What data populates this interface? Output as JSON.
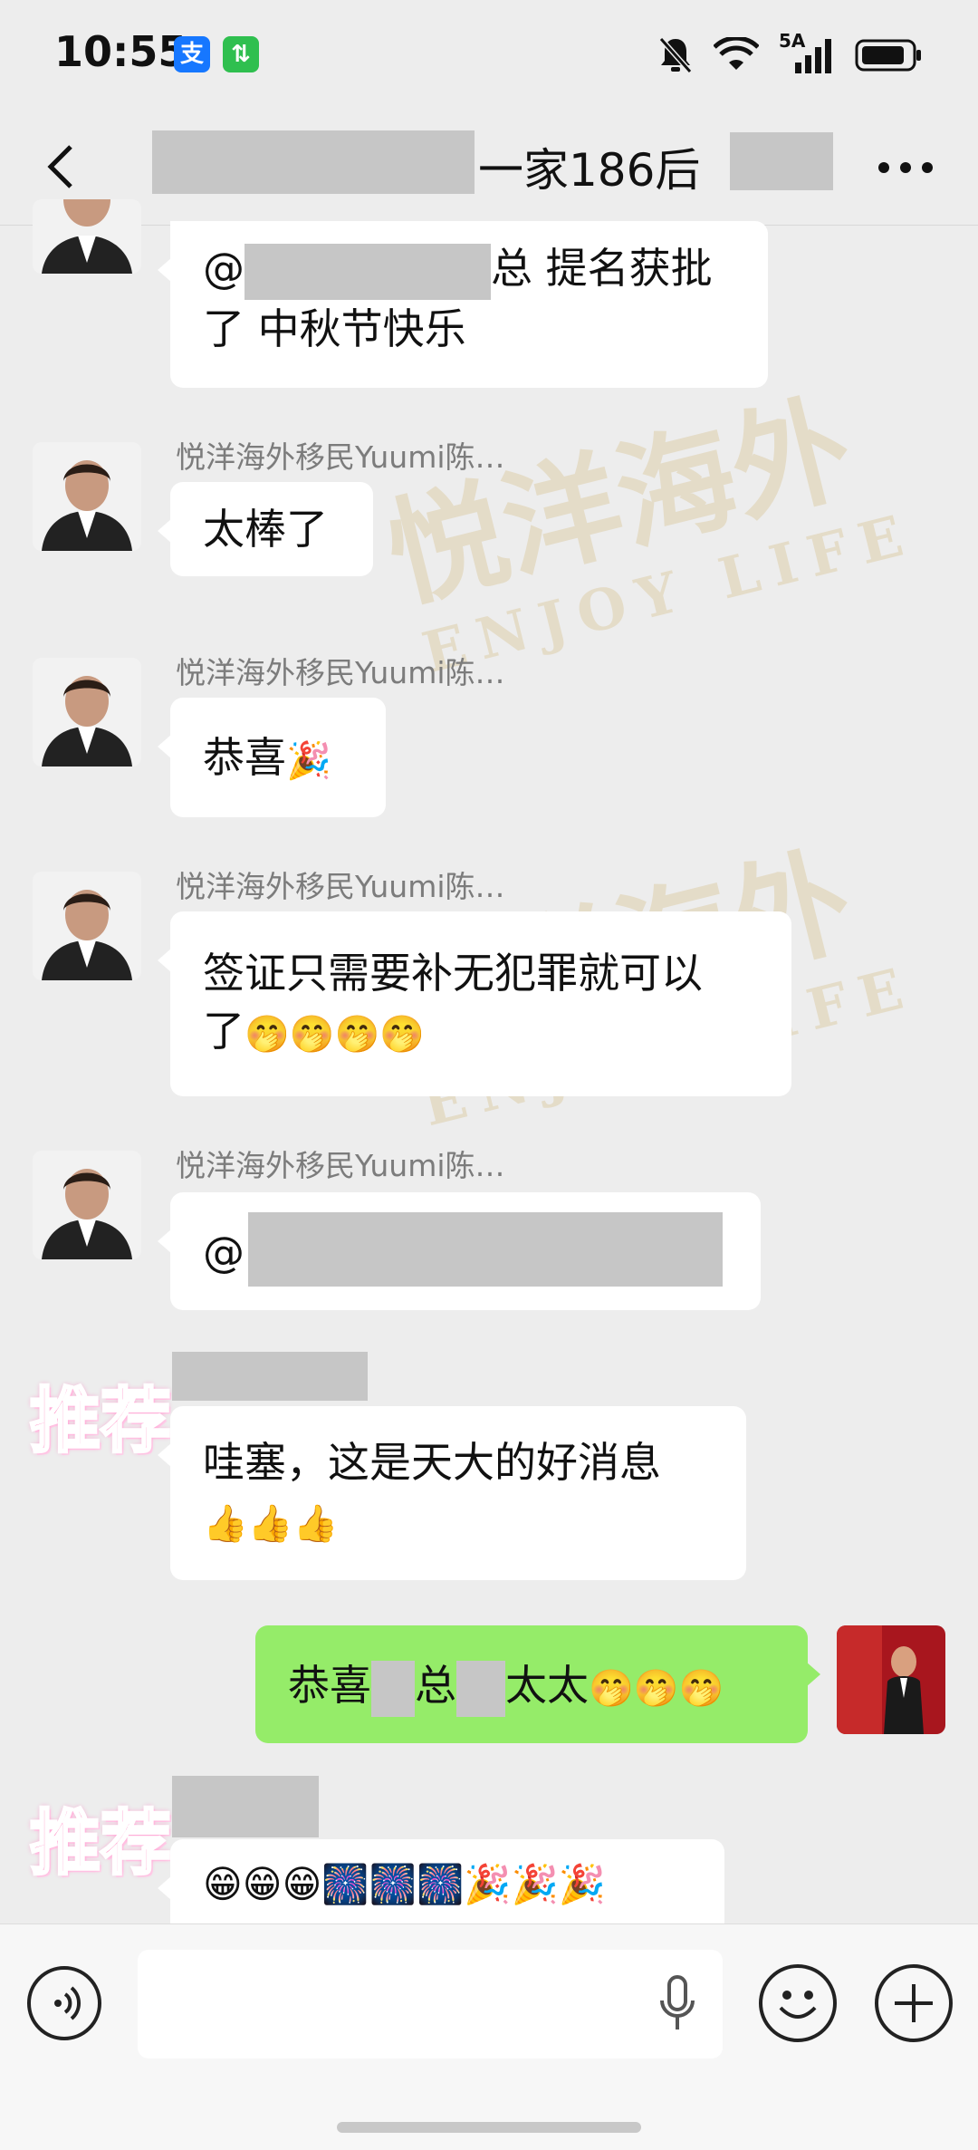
{
  "status_bar": {
    "time": "10:55",
    "app_icons": [
      {
        "name": "alipay-icon",
        "glyph": "支",
        "color": "#1677ff"
      },
      {
        "name": "data-transfer-icon",
        "glyph": "⇅",
        "color": "#2fbf4f"
      }
    ],
    "network_label": "5A"
  },
  "header": {
    "title": "一家186后（"
  },
  "messages": [
    {
      "type": "text",
      "mention": "@",
      "text": "总 提名获批",
      "text2": "了 中秋节快乐"
    },
    {
      "type": "text",
      "sender": "悦洋海外移民Yuumi陈…",
      "text": "太棒了"
    },
    {
      "type": "text",
      "sender": "悦洋海外移民Yuumi陈…",
      "text": "恭喜",
      "emoji": "🎉"
    },
    {
      "type": "text",
      "sender": "悦洋海外移民Yuumi陈…",
      "text": "签证只需要补无犯罪就可以",
      "text2": "了",
      "emoji": "🤭🤭🤭🤭"
    },
    {
      "type": "text",
      "sender": "悦洋海外移民Yuumi陈…",
      "mention": "@"
    },
    {
      "type": "text",
      "sticker": "推荐",
      "text": "哇塞，这是天大的好消息",
      "emoji": "👍👍👍"
    },
    {
      "type": "text",
      "own": true,
      "text_a": "恭喜",
      "text_b": "总",
      "text_c": "太太",
      "emoji": "🤭🤭🤭"
    },
    {
      "type": "text",
      "sticker": "推荐",
      "emoji": "😁😁😁🎆🎆🎆🎉🎉🎉"
    }
  ],
  "watermark": {
    "cn": "悦洋海外",
    "en": "ENJOY LIFE"
  },
  "colors": {
    "background": "#ededed",
    "own_bubble": "#95ec69",
    "other_bubble": "#ffffff",
    "sender_name": "#7c7c7c"
  }
}
